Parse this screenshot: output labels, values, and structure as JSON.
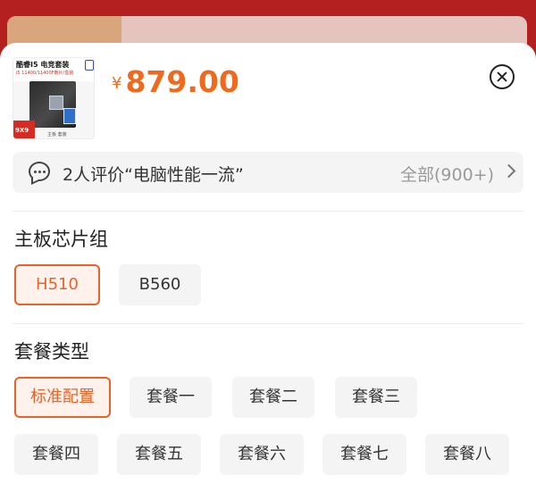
{
  "product": {
    "currency_symbol": "¥",
    "price": "879.00",
    "thumbnail": {
      "title": "酷睿I5 电竞套装",
      "subtitle": "i5 11400/11400F散片/盒装",
      "badge": "9X9",
      "footer": "主板 套装"
    }
  },
  "review": {
    "summary": "2人评价“电脑性能一流”",
    "all_label": "全部(900+)"
  },
  "sections": [
    {
      "title": "主板芯片组",
      "options": [
        {
          "label": "H510",
          "selected": true
        },
        {
          "label": "B560",
          "selected": false
        }
      ]
    },
    {
      "title": "套餐类型",
      "options": [
        {
          "label": "标准配置",
          "selected": true
        },
        {
          "label": "套餐一",
          "selected": false
        },
        {
          "label": "套餐二",
          "selected": false
        },
        {
          "label": "套餐三",
          "selected": false
        },
        {
          "label": "套餐四",
          "selected": false
        },
        {
          "label": "套餐五",
          "selected": false
        },
        {
          "label": "套餐六",
          "selected": false
        },
        {
          "label": "套餐七",
          "selected": false
        },
        {
          "label": "套餐八",
          "selected": false
        }
      ]
    }
  ],
  "colors": {
    "accent": "#e9622a",
    "price": "#f06a1d",
    "backdrop": "#b3201f"
  },
  "icons": {
    "close": "close-circle-icon",
    "review": "chat-bubble-icon",
    "more": "chevron-right-icon"
  }
}
